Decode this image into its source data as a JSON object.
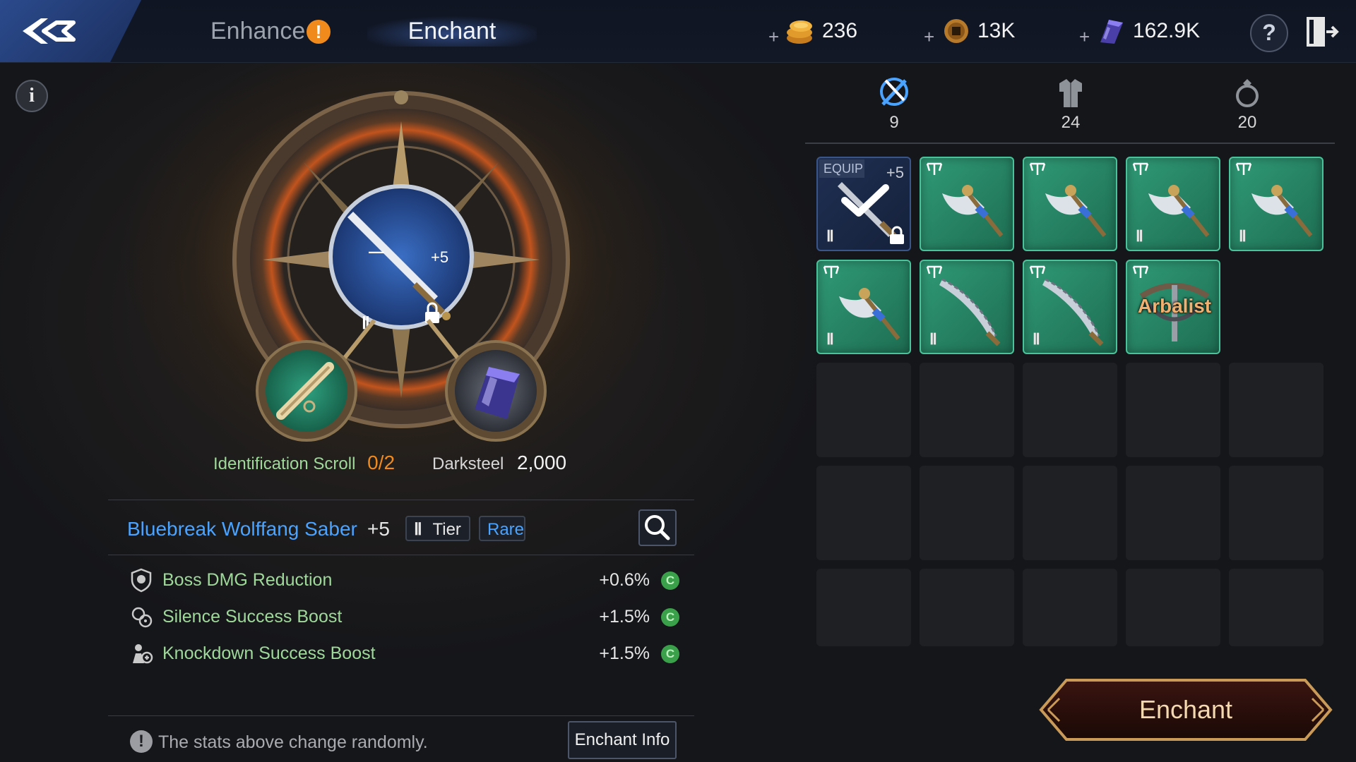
{
  "header": {
    "tabs": [
      {
        "label": "Enhance",
        "alert": "!"
      },
      {
        "label": "Enchant"
      }
    ],
    "currencies": [
      {
        "icon": "gold-coin-stack-icon",
        "value": "236"
      },
      {
        "icon": "ancient-coin-icon",
        "value": "13K"
      },
      {
        "icon": "darksteel-crystal-icon",
        "value": "162.9K"
      }
    ],
    "plus": "+",
    "help": "?"
  },
  "left": {
    "info": "i",
    "slot_item": {
      "plus": "+5",
      "tier": "Ⅱ",
      "minus": "—"
    },
    "materials": [
      {
        "name": "Identification Scroll",
        "amount": "0/2"
      },
      {
        "name": "Darksteel",
        "amount": "2,000"
      }
    ],
    "item": {
      "name": "Bluebreak Wolffang Saber",
      "plus": "+5",
      "tier_mark": "Ⅱ",
      "tier_label": "Tier",
      "rarity": "Rare"
    },
    "stats": [
      {
        "name": "Boss DMG Reduction",
        "value": "+0.6%",
        "badge": "C"
      },
      {
        "name": "Silence Success Boost",
        "value": "+1.5%",
        "badge": "C"
      },
      {
        "name": "Knockdown Success Boost",
        "value": "+1.5%",
        "badge": "C"
      }
    ],
    "note_icon": "!",
    "note": "The stats above change randomly.",
    "enchant_info_label": "Enchant Info"
  },
  "right": {
    "categories": [
      {
        "icon": "weapon-category-icon",
        "count": "9",
        "active": true
      },
      {
        "icon": "armor-category-icon",
        "count": "24",
        "active": false
      },
      {
        "icon": "accessory-ring-icon",
        "count": "20",
        "active": false
      }
    ],
    "inventory": [
      {
        "type": "equipped",
        "equip_label": "EQUIP",
        "plus": "+5",
        "tier": "Ⅱ"
      },
      {
        "type": "axe",
        "tier": ""
      },
      {
        "type": "axe",
        "tier": ""
      },
      {
        "type": "axe",
        "tier": "Ⅱ"
      },
      {
        "type": "axe",
        "tier": "Ⅱ"
      },
      {
        "type": "axe",
        "tier": "Ⅱ"
      },
      {
        "type": "saber",
        "tier": "Ⅱ"
      },
      {
        "type": "saber",
        "tier": "Ⅱ"
      },
      {
        "type": "bow",
        "tier": "",
        "label": "Arbalist"
      }
    ],
    "empty_slots": 16,
    "enchant_button": "Enchant"
  },
  "colors": {
    "accent_blue": "#4aa3ff",
    "stat_green": "#9fd99a",
    "material_orange": "#f08a1c",
    "item_slot_green": "#2f9a76",
    "enchant_text": "#f4d9b0"
  }
}
